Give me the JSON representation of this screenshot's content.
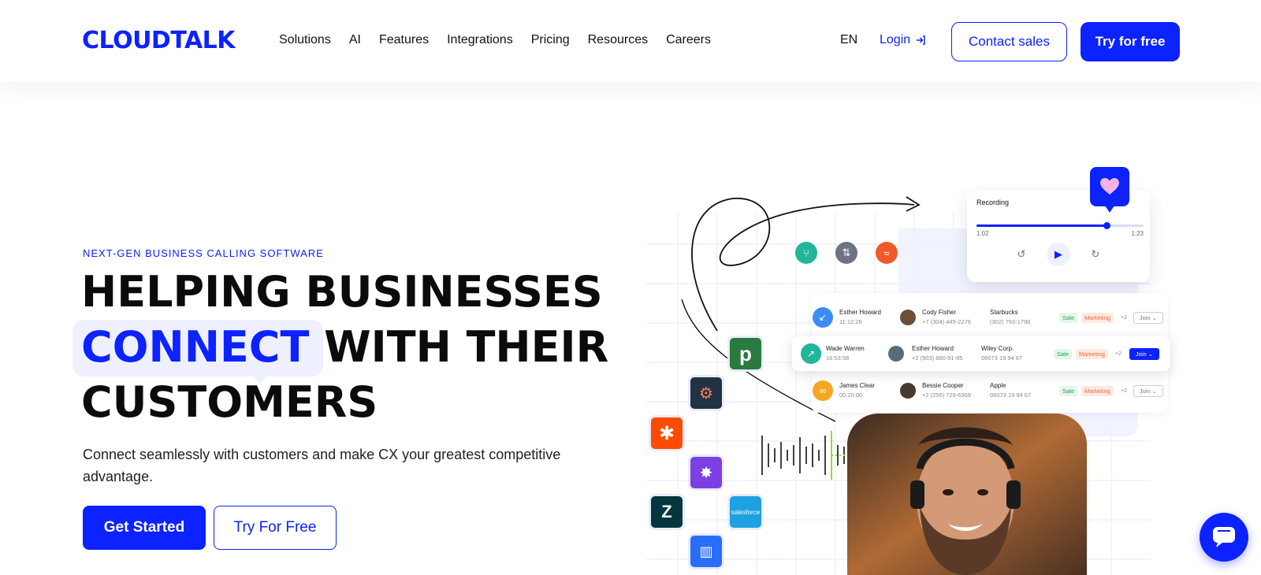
{
  "brand": {
    "logo_text": "CLOUDTALK",
    "accent_color": "#0c22ff"
  },
  "nav": {
    "items": [
      {
        "label": "Solutions"
      },
      {
        "label": "AI"
      },
      {
        "label": "Features"
      },
      {
        "label": "Integrations"
      },
      {
        "label": "Pricing"
      },
      {
        "label": "Resources"
      },
      {
        "label": "Careers"
      }
    ],
    "language": "EN",
    "login_label": "Login",
    "contact_label": "Contact sales",
    "try_label": "Try for free"
  },
  "hero": {
    "eyebrow": "NEXT-GEN BUSINESS CALLING SOFTWARE",
    "headline_line1": "HELPING BUSINESSES",
    "headline_highlight": "CONNECT",
    "headline_line2_rest": " WITH THEIR",
    "headline_line3": "CUSTOMERS",
    "subheadline": "Connect seamlessly with customers and make CX your greatest competitive advantage.",
    "primary_cta": "Get Started",
    "secondary_cta": "Try For Free"
  },
  "recording": {
    "title": "Recording",
    "elapsed": "1:02",
    "duration": "1:23",
    "progress": 0.78
  },
  "calls": [
    {
      "caller": "Esther Howard",
      "time": "11:12:26",
      "contact": "Cody Fisher",
      "contact_phone": "+7 (304) 445-2276",
      "company": "Starbucks",
      "company_phone": "(302) 793-1798",
      "tag1": "Sale",
      "tag2": "Marketing",
      "more": "+2",
      "action": "Join",
      "direction": "incoming",
      "icon_color": "#3b8ef0"
    },
    {
      "caller": "Wade Warren",
      "time": "16:53:58",
      "contact": "Esther Howard",
      "contact_phone": "+2 (903) 880-91-85",
      "company": "Wiley Corp.",
      "company_phone": "06073 19 94 67",
      "tag1": "Sale",
      "tag2": "Marketing",
      "more": "+2",
      "action": "Join",
      "direction": "outgoing",
      "icon_color": "#22b59a"
    },
    {
      "caller": "James Clear",
      "time": "00:20:00",
      "contact": "Bessie Cooper",
      "contact_phone": "+2 (256) 729-6369",
      "company": "Apple",
      "company_phone": "06073 19 94 67",
      "tag1": "Sale",
      "tag2": "Marketing",
      "more": "+2",
      "action": "Join",
      "direction": "voicemail",
      "icon_color": "#f5a623"
    }
  ],
  "integrations": [
    {
      "name": "pipedrive",
      "glyph": "p",
      "color": "#2a7a3f"
    },
    {
      "name": "hubspot",
      "glyph": "hubspot-icon",
      "color": "#213343"
    },
    {
      "name": "zapier",
      "glyph": "zapier-icon",
      "color": "#ff4a00"
    },
    {
      "name": "make",
      "glyph": "burst-icon",
      "color": "#7b3fe4"
    },
    {
      "name": "zendesk",
      "glyph": "Z",
      "color": "#03363d"
    },
    {
      "name": "salesforce",
      "glyph": "salesforce",
      "color": "#1fa0e0"
    },
    {
      "name": "intercom",
      "glyph": "intercom-icon",
      "color": "#286efa"
    }
  ],
  "feature_icons": [
    {
      "name": "split-icon",
      "color": "#22b59a"
    },
    {
      "name": "swap-icon",
      "color": "#6e7383"
    },
    {
      "name": "trend-icon",
      "color": "#f05a2b"
    }
  ]
}
